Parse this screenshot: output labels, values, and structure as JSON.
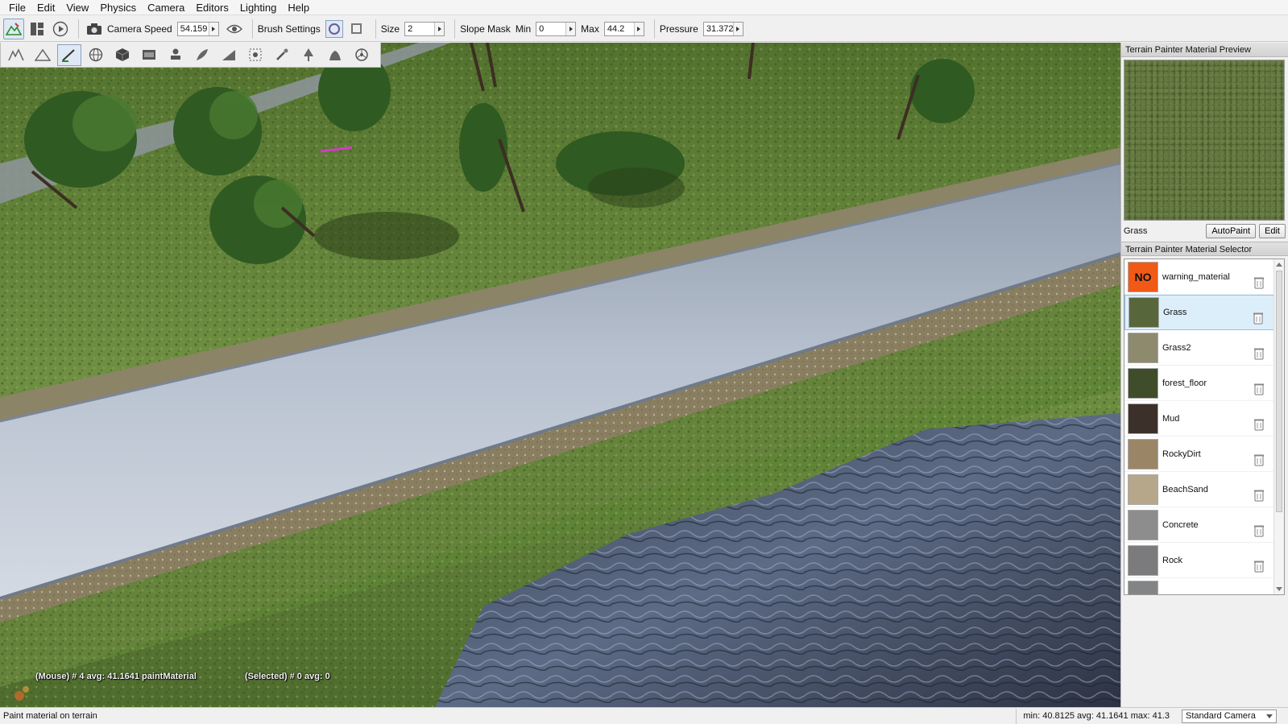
{
  "menu": [
    "File",
    "Edit",
    "View",
    "Physics",
    "Camera",
    "Editors",
    "Lighting",
    "Help"
  ],
  "toolbar": {
    "camera_speed_label": "Camera Speed",
    "camera_speed_value": "54.159",
    "brush_settings_label": "Brush Settings",
    "size_label": "Size",
    "size_value": "2",
    "slope_mask_label": "Slope Mask",
    "min_label": "Min",
    "min_value": "0",
    "max_label": "Max",
    "max_value": "44.2",
    "pressure_label": "Pressure",
    "pressure_value": "31.372"
  },
  "secondary_toolbar_icons": [
    "terrain-editor-icon",
    "raise-height-icon",
    "paint-material-icon",
    "world-icon",
    "cube-icon",
    "decal-icon",
    "stamp-icon",
    "feather-icon",
    "ramp-icon",
    "bounds-icon",
    "brush-icon",
    "tree-icon",
    "mesh-icon",
    "wheel-icon"
  ],
  "viewport": {
    "mouse_readout": "(Mouse) # 4  avg: 41.1641 paintMaterial",
    "selected_readout": "(Selected) # 0  avg: 0"
  },
  "preview_panel": {
    "title": "Terrain Painter Material Preview",
    "material_name": "Grass",
    "autopaint_label": "AutoPaint",
    "edit_label": "Edit"
  },
  "selector_panel": {
    "title": "Terrain Painter Material Selector",
    "materials": [
      {
        "name": "warning_material",
        "color": "#f15a16",
        "badge": "NO"
      },
      {
        "name": "Grass",
        "color": "#58663c",
        "selected": true
      },
      {
        "name": "Grass2",
        "color": "#8e8a6e"
      },
      {
        "name": "forest_floor",
        "color": "#3f4d2a"
      },
      {
        "name": "Mud",
        "color": "#3c302a"
      },
      {
        "name": "RockyDirt",
        "color": "#9a8667"
      },
      {
        "name": "BeachSand",
        "color": "#b6a78a"
      },
      {
        "name": "Concrete",
        "color": "#8d8d8d"
      },
      {
        "name": "Rock",
        "color": "#7b7b7d"
      },
      {
        "name": "",
        "color": "#838486"
      }
    ]
  },
  "status": {
    "message": "Paint material on terrain",
    "stats": "min: 40.8125  avg: 41.1641  max: 41.3",
    "camera_mode": "Standard Camera"
  }
}
